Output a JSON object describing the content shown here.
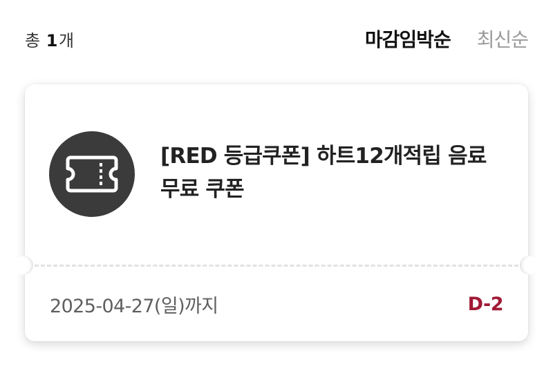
{
  "header": {
    "count_prefix": "총",
    "count_value": "1",
    "count_suffix": "개",
    "sort_options": [
      {
        "label": "마감임박순",
        "active": true
      },
      {
        "label": "최신순",
        "active": false
      }
    ]
  },
  "coupon": {
    "icon": "ticket-icon",
    "title": "[RED 등급쿠폰] 하트12개적립 음료 무료 쿠폰",
    "expiry": "2025-04-27(일)까지",
    "dday": "D-2"
  },
  "colors": {
    "dday": "#a11a36",
    "icon_bg": "#3b3b3b",
    "active_sort": "#111111",
    "inactive_sort": "#9a9a9a"
  }
}
